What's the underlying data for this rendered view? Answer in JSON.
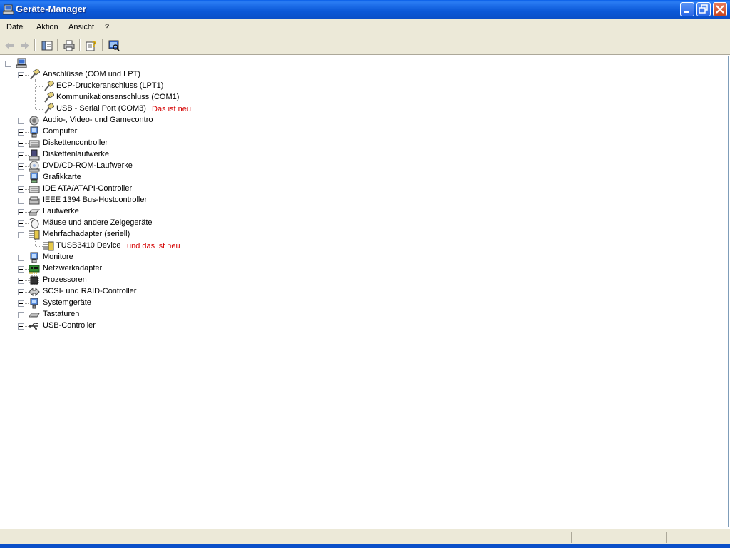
{
  "window": {
    "title": "Geräte-Manager"
  },
  "menu": [
    "Datei",
    "Aktion",
    "Ansicht",
    "?"
  ],
  "tree": {
    "root_icon": "computer-icon",
    "groups": [
      {
        "label": "Anschlüsse (COM und LPT)",
        "icon": "port-icon",
        "expanded": true,
        "children": [
          {
            "label": "ECP-Druckeranschluss (LPT1)",
            "icon": "port-icon"
          },
          {
            "label": "Kommunikationsanschluss (COM1)",
            "icon": "port-icon"
          },
          {
            "label": "USB - Serial Port (COM3)",
            "icon": "port-icon",
            "note": "Das ist neu"
          }
        ]
      },
      {
        "label": "Audio-, Video- und Gamecontro",
        "icon": "speaker-icon"
      },
      {
        "label": "Computer",
        "icon": "monitor-icon"
      },
      {
        "label": "Diskettencontroller",
        "icon": "controller-icon"
      },
      {
        "label": "Diskettenlaufwerke",
        "icon": "floppy-icon"
      },
      {
        "label": "DVD/CD-ROM-Laufwerke",
        "icon": "cdrom-icon"
      },
      {
        "label": "Grafikkarte",
        "icon": "display-adapter-icon"
      },
      {
        "label": "IDE ATA/ATAPI-Controller",
        "icon": "controller-icon"
      },
      {
        "label": "IEEE 1394 Bus-Hostcontroller",
        "icon": "ieee-icon"
      },
      {
        "label": "Laufwerke",
        "icon": "drive-icon"
      },
      {
        "label": "Mäuse und andere Zeigegeräte",
        "icon": "mouse-icon"
      },
      {
        "label": "Mehrfachadapter (seriell)",
        "icon": "multiport-icon",
        "expanded": true,
        "children": [
          {
            "label": "TUSB3410 Device",
            "icon": "multiport-icon",
            "note": "und das ist neu"
          }
        ]
      },
      {
        "label": "Monitore",
        "icon": "monitor-icon"
      },
      {
        "label": "Netzwerkadapter",
        "icon": "network-adapter-icon"
      },
      {
        "label": "Prozessoren",
        "icon": "processor-icon"
      },
      {
        "label": "SCSI- und RAID-Controller",
        "icon": "scsi-icon"
      },
      {
        "label": "Systemgeräte",
        "icon": "system-icon"
      },
      {
        "label": "Tastaturen",
        "icon": "keyboard-icon"
      },
      {
        "label": "USB-Controller",
        "icon": "usb-icon"
      }
    ]
  },
  "colors": {
    "note": "#d40000",
    "titlebar": "#0a5fe8",
    "chrome": "#ece9d8"
  }
}
